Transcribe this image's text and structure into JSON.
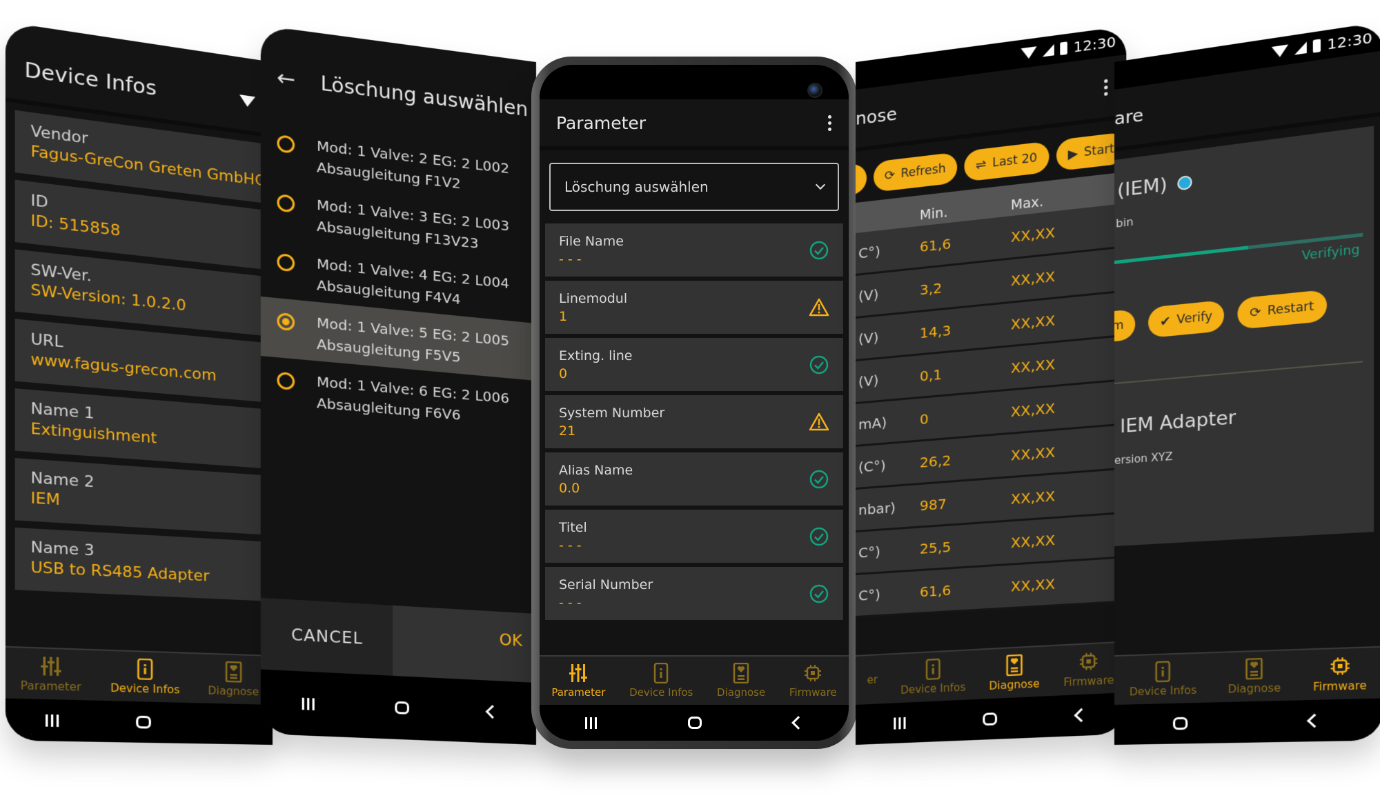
{
  "colors": {
    "accent": "#f5b015",
    "success": "#11a37f",
    "info_dot": "#26aad9",
    "surface": "#333333",
    "background": "#131313"
  },
  "status_bar": {
    "time": "12:30"
  },
  "nav_tabs": [
    {
      "label": "Parameter",
      "icon": "sliders-icon"
    },
    {
      "label": "Device Infos",
      "icon": "phone-info-icon"
    },
    {
      "label": "Diagnose",
      "icon": "heart-report-icon"
    },
    {
      "label": "Firmware",
      "icon": "chip-icon"
    }
  ],
  "device_infos": {
    "title": "Device Infos",
    "items": [
      {
        "label": "Vendor",
        "value": "Fagus-GreCon Greten GmbHCo."
      },
      {
        "label": "ID",
        "value": "ID: 515858"
      },
      {
        "label": "SW-Ver.",
        "value": "SW-Version: 1.0.2.0"
      },
      {
        "label": "URL",
        "value": "www.fagus-grecon.com"
      },
      {
        "label": "Name 1",
        "value": "Extinguishment"
      },
      {
        "label": "Name 2",
        "value": "IEM"
      },
      {
        "label": "Name 3",
        "value": "USB to RS485 Adapter"
      }
    ],
    "active_tab": "Device Infos"
  },
  "loeschung_dialog": {
    "title": "Löschung auswählen",
    "options": [
      {
        "line1": "Mod: 1 Valve: 2 EG: 2 L002",
        "line2": "Absaugleitung F1V2",
        "selected": false
      },
      {
        "line1": "Mod: 1 Valve: 3 EG: 2 L003",
        "line2": "Absaugleitung F13V23",
        "selected": false
      },
      {
        "line1": "Mod: 1 Valve: 4 EG: 2 L004",
        "line2": "Absaugleitung F4V4",
        "selected": false
      },
      {
        "line1": "Mod: 1 Valve: 5 EG: 2 L005",
        "line2": "Absaugleitung F5V5",
        "selected": true
      },
      {
        "line1": "Mod: 1 Valve: 6 EG: 2 L006",
        "line2": "Absaugleitung F6V6",
        "selected": false
      }
    ],
    "cancel_label": "CANCEL",
    "ok_label": "OK"
  },
  "parameter": {
    "title": "Parameter",
    "dropdown_value": "Löschung auswählen",
    "items": [
      {
        "label": "File Name",
        "value": "- - -",
        "status": "ok"
      },
      {
        "label": "Linemodul",
        "value": "1",
        "status": "warning"
      },
      {
        "label": "Exting. line",
        "value": "0",
        "status": "ok"
      },
      {
        "label": "System Number",
        "value": "21",
        "status": "warning"
      },
      {
        "label": "Alias Name",
        "value": "0.0",
        "status": "ok"
      },
      {
        "label": "Titel",
        "value": "- - -",
        "status": "ok"
      },
      {
        "label": "Serial Number",
        "value": "- - -",
        "status": "ok"
      }
    ],
    "active_tab": "Parameter"
  },
  "diagnose": {
    "title_partial": "nose",
    "buttons": [
      {
        "label": "",
        "icon": "partial-button"
      },
      {
        "label": "Refresh",
        "icon": "refresh-icon"
      },
      {
        "label": "Last 20",
        "icon": "swap-icon"
      },
      {
        "label": "Start",
        "icon": "play-icon"
      }
    ],
    "columns": [
      "",
      "Min.",
      "Max."
    ],
    "rows": [
      {
        "name": "C°)",
        "min": "61,6",
        "max": "XX,XX"
      },
      {
        "name": "(V)",
        "min": "3,2",
        "max": "XX,XX"
      },
      {
        "name": " (V)",
        "min": "14,3",
        "max": "XX,XX"
      },
      {
        "name": "(V)",
        "min": "0,1",
        "max": "XX,XX"
      },
      {
        "name": "mA)",
        "min": "0",
        "max": "XX,XX"
      },
      {
        "name": " (C°)",
        "min": "26,2",
        "max": "XX,XX"
      },
      {
        "name": "nbar)",
        "min": "987",
        "max": "XX,XX"
      },
      {
        "name": "C°)",
        "min": "25,5",
        "max": "XX,XX"
      },
      {
        "name": "C°)",
        "min": "61,6",
        "max": "XX,XX"
      }
    ],
    "active_tab": "Diagnose",
    "nav_partial_label": "er"
  },
  "firmware": {
    "title_partial": "are",
    "device_partial": "(IEM)",
    "file_partial": "bin",
    "progress_fraction": 0.55,
    "progress_label": "Verifying",
    "buttons": [
      {
        "label": "am",
        "icon": "partial-button"
      },
      {
        "label": "Verify",
        "icon": "check-circle-icon"
      },
      {
        "label": "Restart",
        "icon": "restart-icon"
      }
    ],
    "adapter_name": "IEM Adapter",
    "version_partial": "ersion XYZ",
    "active_tab": "Firmware"
  }
}
